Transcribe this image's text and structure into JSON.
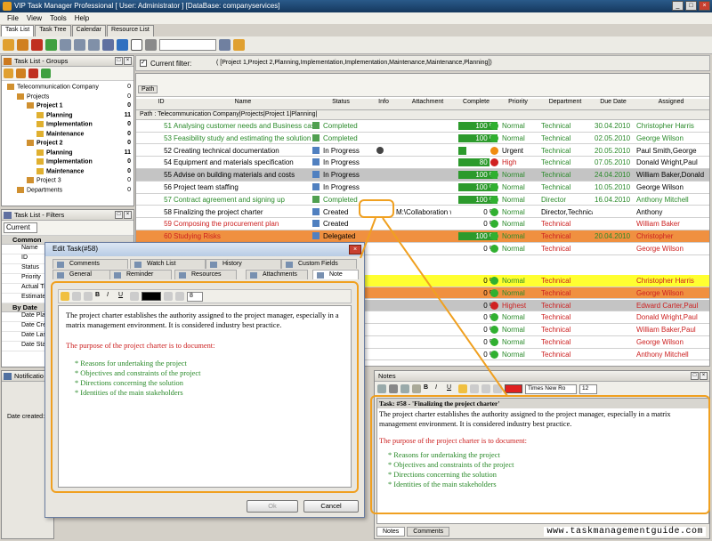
{
  "app": {
    "title": "VIP Task Manager Professional [ User: Administrator ] [DataBase: companyservices]"
  },
  "menu": [
    "File",
    "View",
    "Tools",
    "Help"
  ],
  "main_tabs": [
    "Task List",
    "Task Tree",
    "Calendar",
    "Resource List"
  ],
  "groups_panel": {
    "title": "Task List - Groups",
    "tree": [
      {
        "label": "Telecommunication Company",
        "count": "0",
        "indent": 0,
        "bold": false
      },
      {
        "label": "Projects",
        "count": "0",
        "indent": 1,
        "bold": false
      },
      {
        "label": "Project 1",
        "count": "0",
        "indent": 2,
        "bold": true
      },
      {
        "label": "Planning",
        "count": "11",
        "indent": 3,
        "bold": true
      },
      {
        "label": "Implementation",
        "count": "0",
        "indent": 3,
        "bold": true
      },
      {
        "label": "Maintenance",
        "count": "0",
        "indent": 3,
        "bold": true
      },
      {
        "label": "Project 2",
        "count": "0",
        "indent": 2,
        "bold": true
      },
      {
        "label": "Planning",
        "count": "11",
        "indent": 3,
        "bold": true
      },
      {
        "label": "Implementation",
        "count": "0",
        "indent": 3,
        "bold": true
      },
      {
        "label": "Maintenance",
        "count": "0",
        "indent": 3,
        "bold": true
      },
      {
        "label": "Project 3",
        "count": "0",
        "indent": 2,
        "bold": false
      },
      {
        "label": "Departments",
        "count": "0",
        "indent": 1,
        "bold": false
      }
    ]
  },
  "filters_panel": {
    "title": "Task List - Filters",
    "current": "Current",
    "sections": [
      {
        "name": "Common",
        "fields": [
          "Name",
          "ID",
          "Status",
          "Priority",
          "Actual Tim",
          "Estimated"
        ]
      },
      {
        "name": "By Date",
        "fields": [
          "Date Plan",
          "Date Crea",
          "Date Last",
          "Date Star"
        ]
      }
    ]
  },
  "notifications": {
    "title": "Notificatio",
    "date_created": "Date created:"
  },
  "filter_bar": {
    "label": "Current filter:",
    "value": "( [Project 1,Project 2,Planning,Implementation,Implementation,Maintenance,Maintenance,Planning])"
  },
  "path_label": "Path",
  "columns": [
    "ID",
    "Name",
    "Status",
    "Info",
    "Attachment",
    "Complete",
    "Priority",
    "Department",
    "Due Date",
    "Assigned"
  ],
  "group_row": "Path : Telecommunication Company|Projects|Project 1|Planning|",
  "rows": [
    {
      "id": "51",
      "name": "Analysing customer needs and Business case",
      "status": "Completed",
      "complete": "100 %",
      "pct": 100,
      "priority": "Normal",
      "dept": "Technical",
      "due": "30.04.2010",
      "assigned": "Christopher Harris",
      "color": "#2a8a2a",
      "bg": "#ffffff",
      "picon": "green"
    },
    {
      "id": "53",
      "name": "Feasibility study and estimating the solution",
      "status": "Completed",
      "complete": "100 %",
      "pct": 100,
      "priority": "Normal",
      "dept": "Technical",
      "due": "02.05.2010",
      "assigned": "George Wilson",
      "color": "#2a8a2a",
      "bg": "#ffffff",
      "picon": "green"
    },
    {
      "id": "52",
      "name": "Creating technical documentation",
      "status": "In Progress",
      "complete": "20 %",
      "pct": 20,
      "priority": "Urgent",
      "dept": "Technical",
      "due": "20.05.2010",
      "assigned": "Paul Smith,George",
      "color": "#000000",
      "bg": "#ffffff",
      "picon": "orange",
      "info": true
    },
    {
      "id": "54",
      "name": "Equipment and materials specification",
      "status": "In Progress",
      "complete": "80 %",
      "pct": 80,
      "priority": "High",
      "dept": "Technical",
      "due": "07.05.2010",
      "assigned": "Donald Wright,Paul",
      "color": "#000000",
      "bg": "#ffffff",
      "picon": "red"
    },
    {
      "id": "55",
      "name": "Advise on building materials and costs",
      "status": "In Progress",
      "complete": "100 %",
      "pct": 100,
      "priority": "Normal",
      "dept": "Technical",
      "due": "24.04.2010",
      "assigned": "William Baker,Donald",
      "color": "#000000",
      "bg": "#c4c4c4",
      "picon": "green"
    },
    {
      "id": "56",
      "name": "Project team staffing",
      "status": "In Progress",
      "complete": "100 %",
      "pct": 100,
      "priority": "Normal",
      "dept": "Technical",
      "due": "10.05.2010",
      "assigned": "George Wilson",
      "color": "#000000",
      "bg": "#ffffff",
      "picon": "green"
    },
    {
      "id": "57",
      "name": "Contract agreement and signing up",
      "status": "Completed",
      "complete": "100 %",
      "pct": 100,
      "priority": "Normal",
      "dept": "Director",
      "due": "16.04.2010",
      "assigned": "Anthony Mitchell",
      "color": "#2a8a2a",
      "bg": "#ffffff",
      "picon": "green"
    },
    {
      "id": "58",
      "name": "Finalizing the project charter",
      "status": "Created",
      "complete": "0 %",
      "pct": 0,
      "priority": "Normal",
      "dept": "Director,Technica",
      "due": "",
      "assigned": "Anthony",
      "color": "#000000",
      "bg": "#ffffff",
      "picon": "green",
      "attach": "M:\\Collaboration with",
      "info2": true
    },
    {
      "id": "59",
      "name": "Composing the procurement plan",
      "status": "Created",
      "complete": "0 %",
      "pct": 0,
      "priority": "Normal",
      "dept": "Technical",
      "due": "",
      "assigned": "William Baker",
      "color": "#cc2020",
      "bg": "#ffffff",
      "picon": "green"
    },
    {
      "id": "60",
      "name": "Studying Risks",
      "status": "Delegated",
      "complete": "100 %",
      "pct": 100,
      "priority": "Normal",
      "dept": "Technical",
      "due": "20.04.2010",
      "assigned": "Christopher",
      "color": "#cc2020",
      "bg": "#f09040",
      "picon": "green"
    },
    {
      "id": "",
      "name": "",
      "status": "",
      "complete": "0 %",
      "pct": 0,
      "priority": "Normal",
      "dept": "Technical",
      "due": "",
      "assigned": "George Wilson",
      "color": "#cc2020",
      "bg": "#ffffff",
      "picon": "green"
    }
  ],
  "rows2": [
    {
      "complete": "0 %",
      "priority": "Normal",
      "dept": "Technical",
      "assigned": "Christopher Harris",
      "color": "#cc2020",
      "bg": "#ffff30",
      "picon": "green"
    },
    {
      "complete": "0 %",
      "priority": "Normal",
      "dept": "Technical",
      "assigned": "George Wilson",
      "color": "#cc2020",
      "bg": "#f09040",
      "picon": "green"
    },
    {
      "complete": "0 %",
      "priority": "Highest",
      "dept": "Technical",
      "assigned": "Edward Carter,Paul",
      "color": "#cc2020",
      "bg": "#c4c4c4",
      "picon": "red"
    },
    {
      "complete": "0 %",
      "priority": "Normal",
      "dept": "Technical",
      "assigned": "Donald Wright,Paul",
      "color": "#cc2020",
      "bg": "#ffffff",
      "picon": "green"
    },
    {
      "complete": "0 %",
      "priority": "Normal",
      "dept": "Technical",
      "assigned": "William Baker,Paul",
      "color": "#cc2020",
      "bg": "#ffffff",
      "picon": "green"
    },
    {
      "complete": "0 %",
      "priority": "Normal",
      "dept": "Technical",
      "assigned": "George Wilson",
      "color": "#cc2020",
      "bg": "#ffffff",
      "picon": "green"
    },
    {
      "complete": "0 %",
      "priority": "Normal",
      "dept": "Technical",
      "assigned": "Anthony Mitchell",
      "color": "#cc2020",
      "bg": "#ffffff",
      "picon": "green"
    }
  ],
  "edit_dialog": {
    "title": "Edit Task(#58)",
    "tabs_top": [
      "Comments",
      "Watch List",
      "History",
      "Custom Fields"
    ],
    "tabs_bottom": [
      "General",
      "Reminder",
      "Resources",
      "Attachments",
      "Note"
    ],
    "font_size": "8",
    "ok": "Ok",
    "cancel": "Cancel"
  },
  "note": {
    "p1": "The project charter establishes the authority assigned to the project manager, especially in a matrix management environment. It is considered industry best practice.",
    "p2": "The purpose of the project charter is to document:",
    "items": [
      "* Reasons for undertaking the project",
      "* Objectives and constraints of the project",
      "* Directions concerning the solution",
      "* Identities of the main stakeholders"
    ]
  },
  "notes_panel": {
    "title": "Notes",
    "font": "Times New Ro",
    "size": "12",
    "task_title": "Task: #58 - 'Finalizing the project charter'",
    "p1": "The project charter establishes the authority assigned to the project manager, especially in a matrix management environment. It is considered industry best practice.",
    "tabs": [
      "Notes",
      "Comments"
    ]
  },
  "watermark": "www.taskmanagementguide.com",
  "colors": {
    "accent": "#f0a020",
    "green_text": "#2a8a2a",
    "red_text": "#cc2020"
  }
}
